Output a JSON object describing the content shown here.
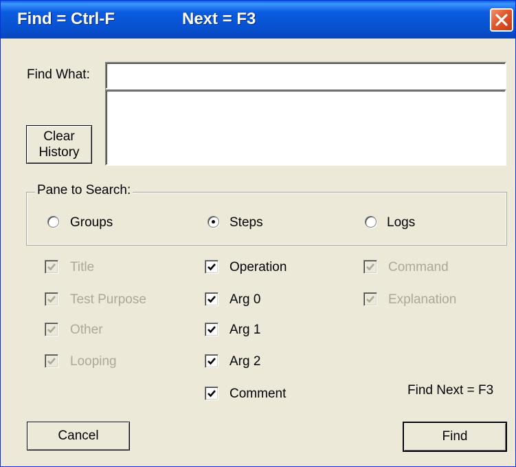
{
  "window": {
    "title_find": "Find = Ctrl-F",
    "title_next": "Next = F3"
  },
  "find_what": {
    "label": "Find What:",
    "value": "",
    "history": []
  },
  "clear_history": {
    "line1": "Clear",
    "line2": "History"
  },
  "pane": {
    "legend": "Pane to Search:",
    "options": [
      {
        "label": "Groups",
        "selected": false
      },
      {
        "label": "Steps",
        "selected": true
      },
      {
        "label": "Logs",
        "selected": false
      }
    ]
  },
  "checkboxes": {
    "groups_col": [
      {
        "label": "Title",
        "checked": true,
        "enabled": false
      },
      {
        "label": "Test Purpose",
        "checked": true,
        "enabled": false
      },
      {
        "label": "Other",
        "checked": true,
        "enabled": false
      },
      {
        "label": "Looping",
        "checked": true,
        "enabled": false
      }
    ],
    "steps_col": [
      {
        "label": "Operation",
        "checked": true,
        "enabled": true
      },
      {
        "label": "Arg 0",
        "checked": true,
        "enabled": true
      },
      {
        "label": "Arg 1",
        "checked": true,
        "enabled": true
      },
      {
        "label": "Arg 2",
        "checked": true,
        "enabled": true
      },
      {
        "label": "Comment",
        "checked": true,
        "enabled": true
      }
    ],
    "logs_col": [
      {
        "label": "Command",
        "checked": true,
        "enabled": false
      },
      {
        "label": "Explanation",
        "checked": true,
        "enabled": false
      }
    ]
  },
  "hint": "Find Next = F3",
  "buttons": {
    "cancel": "Cancel",
    "find": "Find"
  },
  "colors": {
    "titlebar": "#0A5CE0",
    "dialog_bg": "#ECE9D8",
    "disabled_text": "#ACA899",
    "close_red": "#E0582C"
  }
}
